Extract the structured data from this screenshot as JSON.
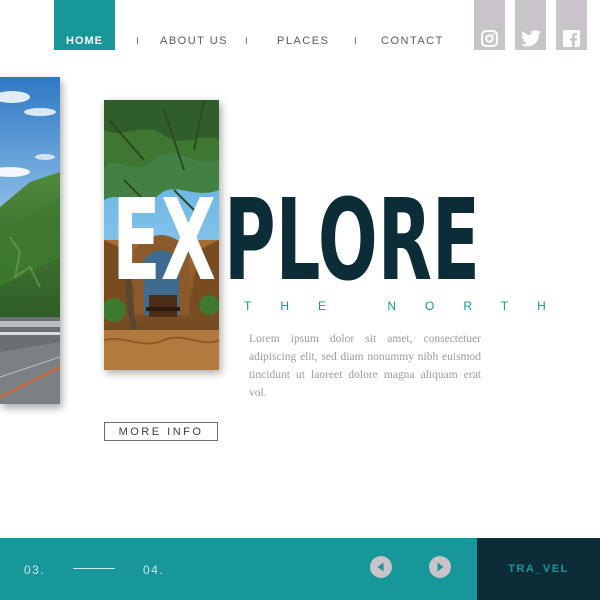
{
  "nav": {
    "home": "HOME",
    "items": [
      "ABOUT US",
      "PLACES",
      "CONTACT"
    ],
    "separator": "I"
  },
  "social": [
    "instagram-icon",
    "twitter-icon",
    "facebook-icon"
  ],
  "hero": {
    "headline_white": "EX",
    "headline_dark": "PLORE",
    "subtitle": "THE NORTH",
    "body": "Lorem ipsum dolor sit amet, consectetuer adipiscing elit, sed diam nonummy nibh euismod tincidunt ut laoreet dolore magna aliquam erat vol.",
    "cta": "MORE INFO"
  },
  "footer": {
    "current": "03.",
    "next": "04.",
    "prev_icon": "arrow-left-icon",
    "next_icon": "arrow-right-icon",
    "brand": "TRA_VEL"
  },
  "colors": {
    "accent": "#17979a",
    "dark": "#0c2c37",
    "social_bg": "#c8c4ca"
  }
}
